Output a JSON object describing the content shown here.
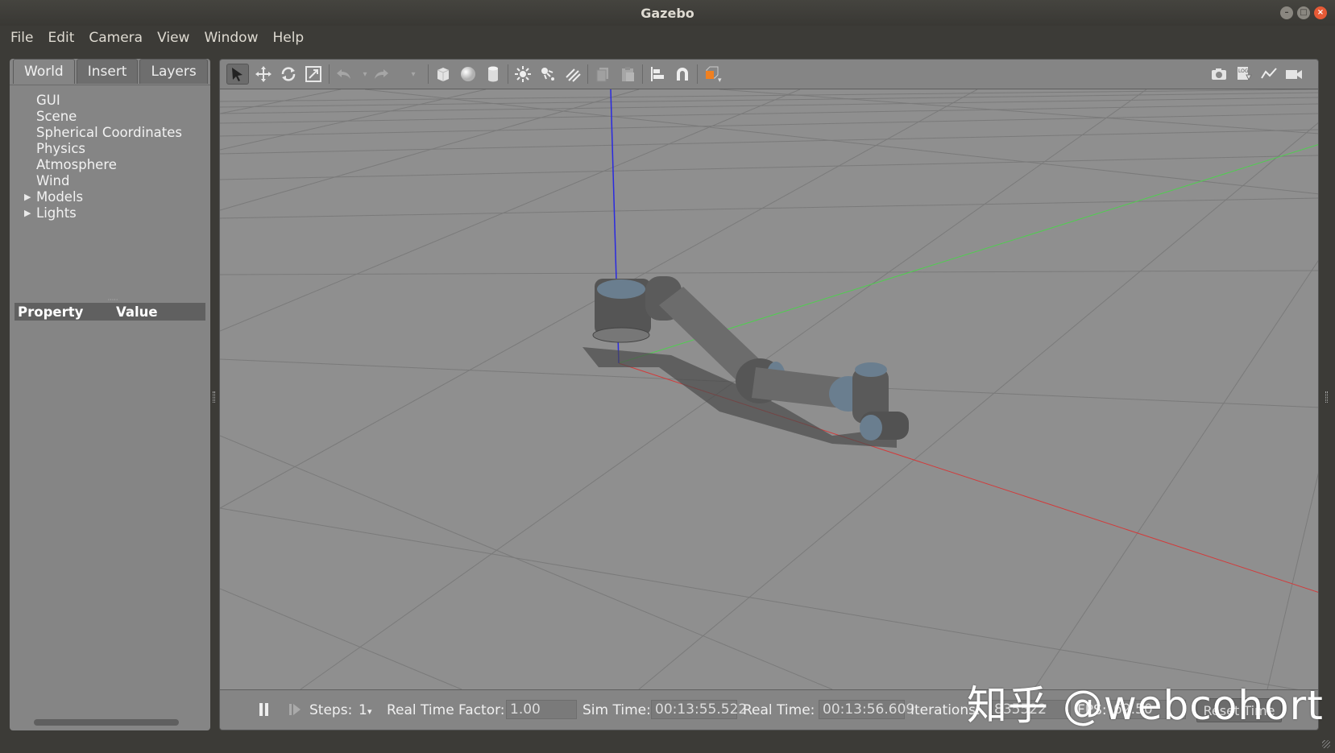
{
  "window": {
    "title": "Gazebo"
  },
  "menubar": {
    "items": [
      "File",
      "Edit",
      "Camera",
      "View",
      "Window",
      "Help"
    ]
  },
  "left_panel": {
    "tabs": [
      "World",
      "Insert",
      "Layers"
    ],
    "active_tab": "World",
    "tree": [
      "GUI",
      "Scene",
      "Spherical Coordinates",
      "Physics",
      "Atmosphere",
      "Wind",
      "Models",
      "Lights"
    ],
    "property_header": {
      "property": "Property",
      "value": "Value"
    }
  },
  "toolbar": {
    "left_icons": [
      "select-mode-icon",
      "translate-mode-icon",
      "rotate-mode-icon",
      "scale-mode-icon",
      "undo-icon",
      "undo-dropdown-icon",
      "redo-icon",
      "redo-dropdown-icon",
      "box-shape-icon",
      "sphere-shape-icon",
      "cylinder-shape-icon",
      "point-light-icon",
      "spot-light-icon",
      "directional-light-icon",
      "copy-icon",
      "paste-icon",
      "align-icon",
      "snap-icon",
      "view-angle-icon"
    ],
    "right_icons": [
      "screenshot-icon",
      "log-icon",
      "plot-icon",
      "record-video-icon"
    ]
  },
  "bottom_bar": {
    "steps_label": "Steps:",
    "steps_value": "1",
    "rtf_label": "Real Time Factor:",
    "rtf_value": "1.00",
    "sim_time_label": "Sim Time:",
    "sim_time_value": "00:13:55.522",
    "real_time_label": "Real Time:",
    "real_time_value": "00:13:56.609",
    "iterations_label": "Iterations:",
    "iterations_value": "835522",
    "fps_label": "FPS:",
    "fps_value": "62.50",
    "reset_label": "Reset Time"
  },
  "watermark": "知乎 @webcohort",
  "colors": {
    "viewport_bg": "#8e8e8e",
    "axis_x": "#d33a3a",
    "axis_y": "#4fcf4f",
    "axis_z": "#2a2ae0",
    "accent_orange": "#f08020"
  }
}
